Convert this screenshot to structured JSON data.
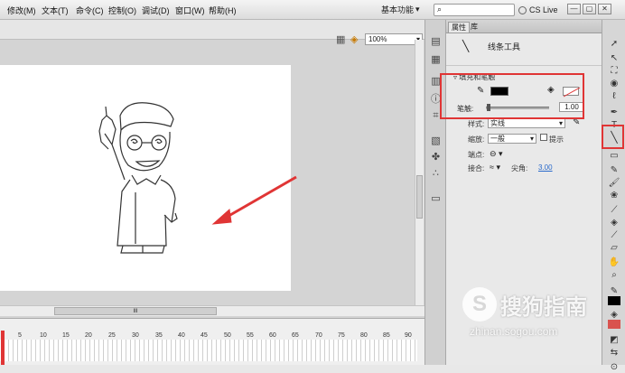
{
  "menubar": {
    "items": [
      "修改(M)",
      "文本(T)",
      "命令(C)",
      "控制(O)",
      "调试(D)",
      "窗口(W)",
      "帮助(H)"
    ],
    "workspace": "基本功能",
    "search_placeholder": "",
    "cs_live": "CS Live",
    "window_buttons": [
      "—",
      "▢",
      "✕"
    ]
  },
  "document": {
    "zoom": "100%",
    "ruler_ticks": [
      "5",
      "10",
      "15",
      "20",
      "25",
      "30",
      "35",
      "40",
      "45",
      "50",
      "55",
      "60",
      "65",
      "70",
      "75",
      "80",
      "85",
      "90"
    ],
    "scroll_grip": "III"
  },
  "properties": {
    "tabs": [
      "属性",
      "库"
    ],
    "tool_name": "线条工具",
    "section": "填充和笔触",
    "stroke_label": "笔触:",
    "stroke_value": "1.00",
    "style_label": "样式:",
    "style_value": "实线",
    "scale_label": "缩放:",
    "scale_value": "一般",
    "hint_label": "提示",
    "cap_label": "端点:",
    "join_label": "接合:",
    "miter_label": "尖角:",
    "miter_value": "3.00"
  },
  "watermark": {
    "text": "搜狗指南",
    "url": "zhinan.sogou.com"
  },
  "colors": {
    "highlight": "#e03535",
    "stroke_color": "#000000"
  }
}
